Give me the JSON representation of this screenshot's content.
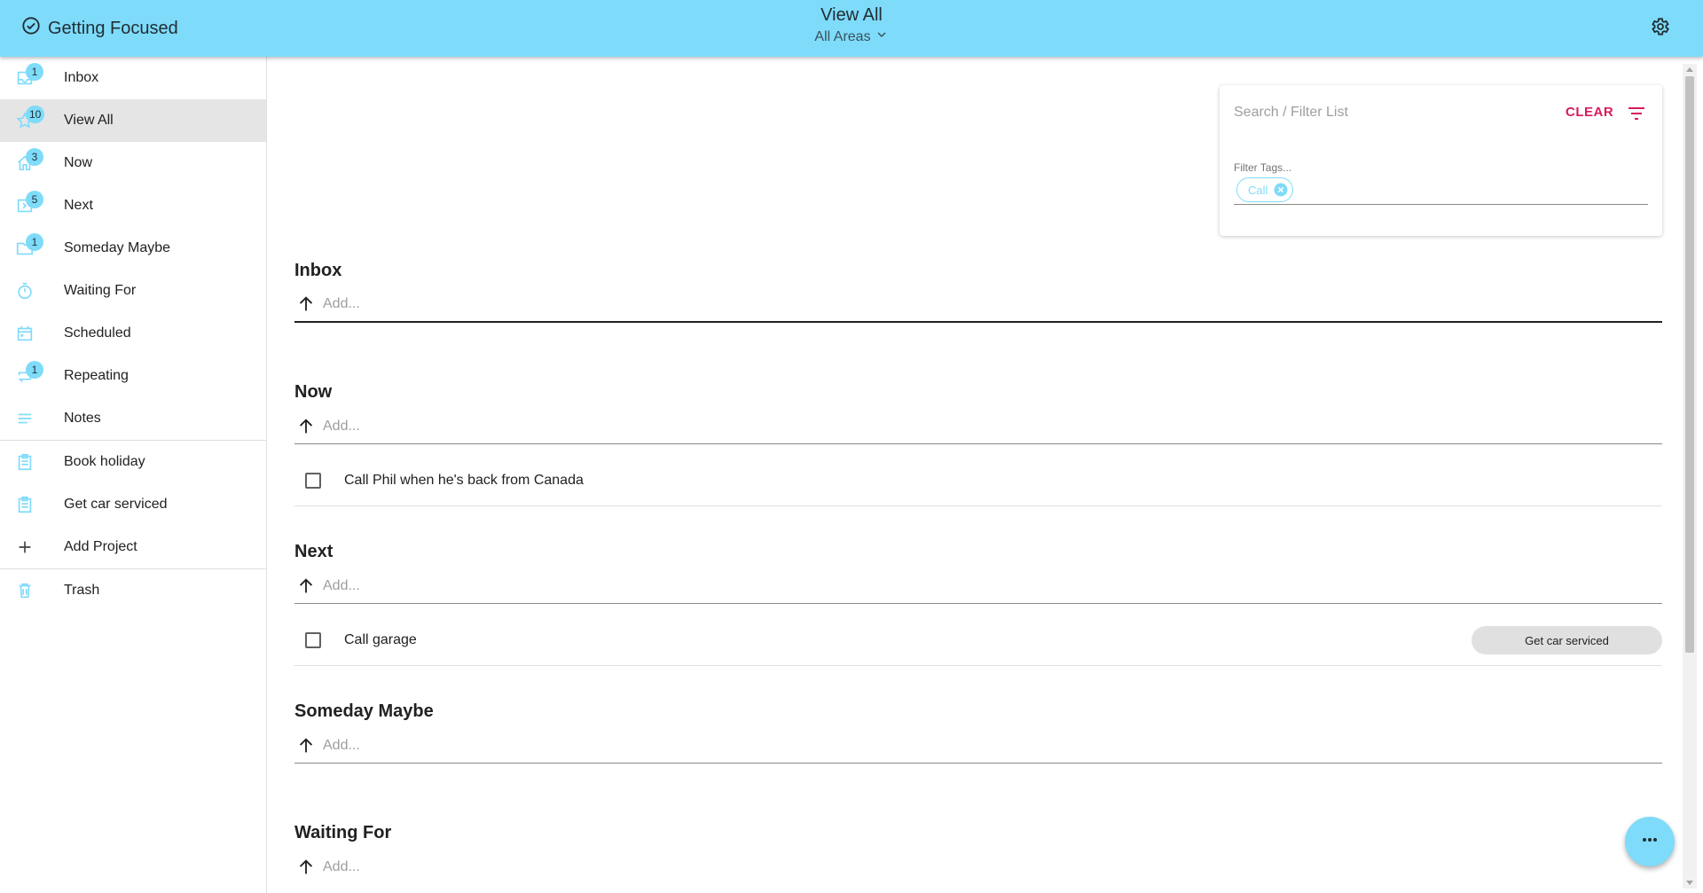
{
  "header": {
    "app_name": "Getting Focused",
    "view_title": "View All",
    "area_selector": "All Areas"
  },
  "sidebar": {
    "items": [
      {
        "label": "Inbox",
        "badge": "1",
        "icon": "inbox-icon"
      },
      {
        "label": "View All",
        "badge": "10",
        "icon": "star-icon",
        "active": true
      },
      {
        "label": "Now",
        "badge": "3",
        "icon": "home-icon"
      },
      {
        "label": "Next",
        "badge": "5",
        "icon": "next-box-icon"
      },
      {
        "label": "Someday Maybe",
        "badge": "1",
        "icon": "folder-icon"
      },
      {
        "label": "Waiting For",
        "badge": "",
        "icon": "timer-icon"
      },
      {
        "label": "Scheduled",
        "badge": "",
        "icon": "calendar-icon"
      },
      {
        "label": "Repeating",
        "badge": "1",
        "icon": "repeat-icon"
      },
      {
        "label": "Notes",
        "badge": "",
        "icon": "notes-icon"
      }
    ],
    "projects": [
      {
        "label": "Book holiday",
        "icon": "clipboard-icon"
      },
      {
        "label": "Get car serviced",
        "icon": "clipboard-icon"
      }
    ],
    "add_project": "Add Project",
    "trash": "Trash"
  },
  "filter": {
    "search_placeholder": "Search / Filter List",
    "clear_label": "CLEAR",
    "tags_label": "Filter Tags...",
    "tags": [
      "Call"
    ]
  },
  "sections": [
    {
      "title": "Inbox",
      "add_placeholder": "Add...",
      "tasks": []
    },
    {
      "title": "Now",
      "add_placeholder": "Add...",
      "tasks": [
        {
          "text": "Call Phil when he's back from Canada",
          "project": ""
        }
      ]
    },
    {
      "title": "Next",
      "add_placeholder": "Add...",
      "tasks": [
        {
          "text": "Call garage",
          "project": "Get car serviced"
        }
      ]
    },
    {
      "title": "Someday Maybe",
      "add_placeholder": "Add...",
      "tasks": []
    },
    {
      "title": "Waiting For",
      "add_placeholder": "Add...",
      "tasks": []
    }
  ],
  "colors": {
    "accent": "#7fdbfa",
    "clear": "#d81b60"
  }
}
